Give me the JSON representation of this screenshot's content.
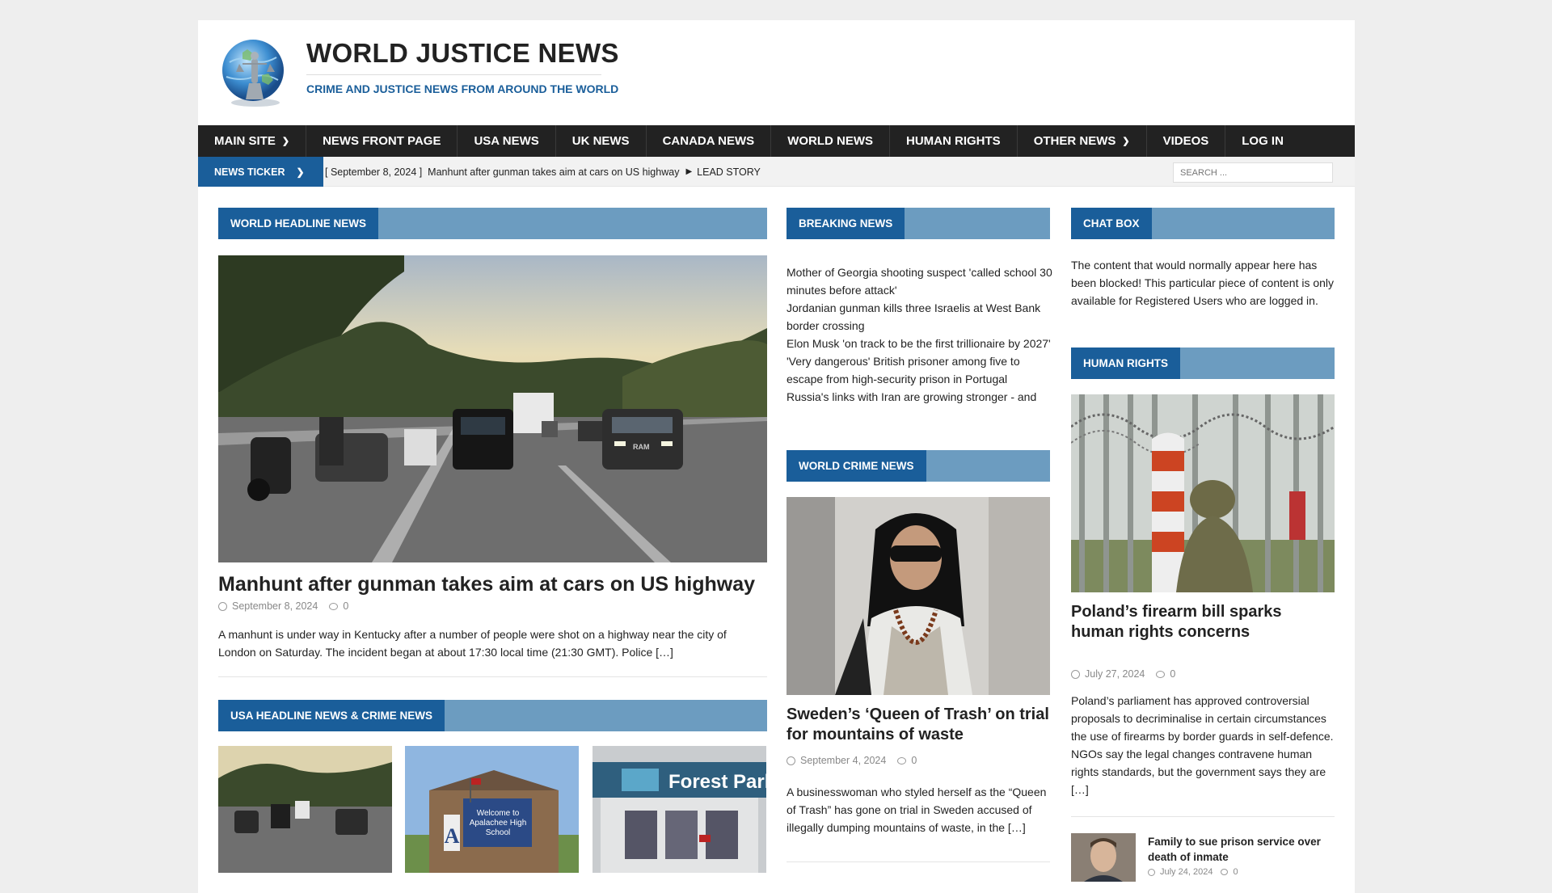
{
  "site": {
    "title": "WORLD JUSTICE NEWS",
    "tagline": "CRIME AND JUSTICE NEWS FROM AROUND THE WORLD"
  },
  "nav": [
    {
      "label": "MAIN SITE",
      "dropdown": true
    },
    {
      "label": "NEWS FRONT PAGE",
      "dropdown": false
    },
    {
      "label": "USA NEWS",
      "dropdown": false
    },
    {
      "label": "UK NEWS",
      "dropdown": false
    },
    {
      "label": "CANADA NEWS",
      "dropdown": false
    },
    {
      "label": "WORLD NEWS",
      "dropdown": false
    },
    {
      "label": "HUMAN RIGHTS",
      "dropdown": false
    },
    {
      "label": "OTHER NEWS",
      "dropdown": true
    },
    {
      "label": "VIDEOS",
      "dropdown": false
    },
    {
      "label": "LOG IN",
      "dropdown": false
    }
  ],
  "ticker": {
    "label": "NEWS TICKER",
    "date": "[ September 8, 2024 ]",
    "headline": "Manhunt after gunman takes aim at cars on US highway",
    "category": "LEAD STORY"
  },
  "search": {
    "placeholder": "SEARCH ..."
  },
  "world_headline": {
    "section": "WORLD HEADLINE NEWS",
    "title": "Manhunt after gunman takes aim at cars on US highway",
    "date": "September 8, 2024",
    "comments": "0",
    "excerpt": "A manhunt is under way in Kentucky after a number of people were shot on a highway near the city of London on Saturday. The incident began at about 17:30 local time (21:30 GMT). Police […]"
  },
  "usa_headline": {
    "section": "USA HEADLINE NEWS & CRIME NEWS"
  },
  "breaking": {
    "section": "BREAKING NEWS",
    "items": [
      "Mother of Georgia shooting suspect 'called school 30 minutes before attack'",
      "Jordanian gunman kills three Israelis at West Bank border crossing",
      "Elon Musk 'on track to be the first trillionaire by 2027'",
      "'Very dangerous' British prisoner among five to escape from high-security prison in Portugal",
      "Russia's links with Iran are growing stronger - and"
    ]
  },
  "world_crime": {
    "section": "WORLD CRIME NEWS",
    "title": "Sweden’s ‘Queen of Trash’ on trial for mountains of waste",
    "date": "September 4, 2024",
    "comments": "0",
    "excerpt": "A businesswoman who styled herself as the “Queen of Trash” has gone on trial in Sweden accused of illegally dumping mountains of waste, in the […]"
  },
  "chat_box": {
    "section": "CHAT BOX",
    "text": "The content that would normally appear here has been blocked! This particular piece of content is only available for Registered Users who are logged in."
  },
  "human_rights": {
    "section": "HUMAN RIGHTS",
    "title": "Poland’s firearm bill sparks human rights concerns",
    "date": "July 27, 2024",
    "comments": "0",
    "excerpt": "Poland’s parliament has approved controversial proposals to decriminalise in certain circumstances the use of firearms by border guards in self-defence. NGOs say the legal changes contravene human rights standards, but the government says they are […]",
    "small_title": "Family to sue prison service over death of inmate",
    "small_date": "July 24, 2024",
    "small_comments": "0"
  },
  "photo_text": {
    "school_sign": "Welcome to Apalachee High School",
    "school_letter": "A",
    "station_sign": "Forest Park",
    "truck_badge": "RAM"
  },
  "colors": {
    "brand_blue": "#1a5e9a",
    "section_bar": "#6c9cc0",
    "nav_bg": "#222222"
  }
}
